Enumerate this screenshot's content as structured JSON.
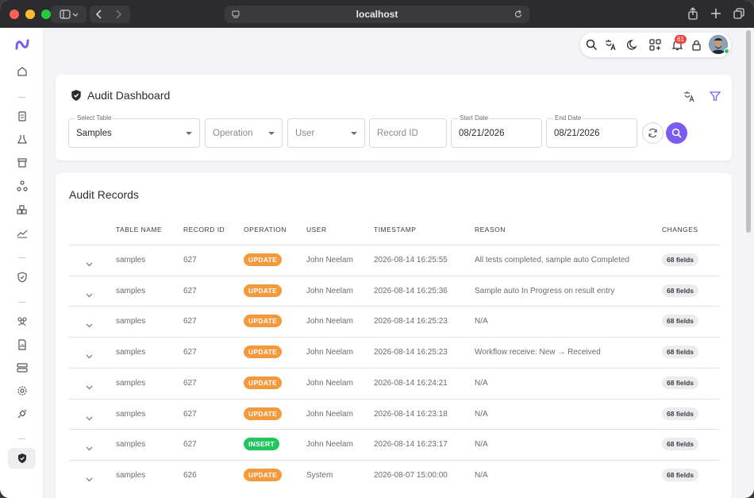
{
  "browser": {
    "address": "localhost"
  },
  "topbar": {
    "notification_count": "61"
  },
  "audit": {
    "title": "Audit Dashboard",
    "filters": {
      "table_label": "Select Table",
      "table_value": "Samples",
      "operation_placeholder": "Operation",
      "user_placeholder": "User",
      "record_placeholder": "Record ID",
      "start_label": "Start Date",
      "start_value": "08/21/2026",
      "end_label": "End Date",
      "end_value": "08/21/2026"
    }
  },
  "records": {
    "title": "Audit Records",
    "columns": [
      "TABLE NAME",
      "RECORD ID",
      "OPERATION",
      "USER",
      "TIMESTAMP",
      "REASON",
      "CHANGES"
    ],
    "rows": [
      {
        "table": "samples",
        "record": "627",
        "op": "UPDATE",
        "user": "John Neelam",
        "ts": "2026-08-14 16:25:55",
        "reason": "All tests completed, sample auto Completed",
        "changes": "68 fields"
      },
      {
        "table": "samples",
        "record": "627",
        "op": "UPDATE",
        "user": "John Neelam",
        "ts": "2026-08-14 16:25:36",
        "reason": "Sample auto In Progress on result entry",
        "changes": "68 fields"
      },
      {
        "table": "samples",
        "record": "627",
        "op": "UPDATE",
        "user": "John Neelam",
        "ts": "2026-08-14 16:25:23",
        "reason": "N/A",
        "changes": "68 fields"
      },
      {
        "table": "samples",
        "record": "627",
        "op": "UPDATE",
        "user": "John Neelam",
        "ts": "2026-08-14 16:25:23",
        "reason": "Workflow receive: New → Received",
        "changes": "68 fields"
      },
      {
        "table": "samples",
        "record": "627",
        "op": "UPDATE",
        "user": "John Neelam",
        "ts": "2026-08-14 16:24:21",
        "reason": "N/A",
        "changes": "68 fields"
      },
      {
        "table": "samples",
        "record": "627",
        "op": "UPDATE",
        "user": "John Neelam",
        "ts": "2026-08-14 16:23:18",
        "reason": "N/A",
        "changes": "68 fields"
      },
      {
        "table": "samples",
        "record": "627",
        "op": "INSERT",
        "user": "John Neelam",
        "ts": "2026-08-14 16:23:17",
        "reason": "N/A",
        "changes": "68 fields"
      },
      {
        "table": "samples",
        "record": "626",
        "op": "UPDATE",
        "user": "System",
        "ts": "2026-08-07 15:00:00",
        "reason": "N/A",
        "changes": "68 fields"
      }
    ]
  },
  "colors": {
    "accent": "#7c5cf0",
    "update": "#f59a3c",
    "insert": "#22c55e"
  }
}
